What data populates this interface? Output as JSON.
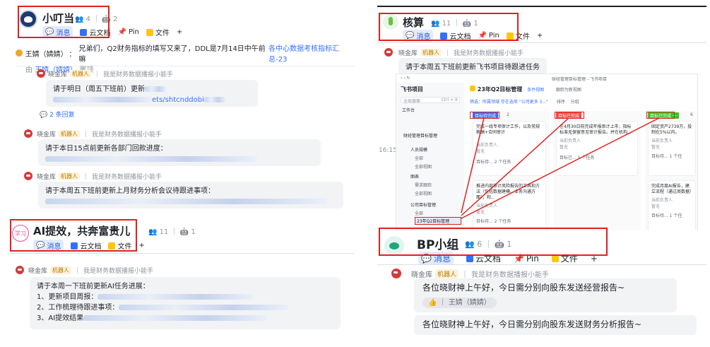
{
  "group1": {
    "name": "小叮当",
    "members": "4",
    "bots": "2",
    "tabs": [
      "消息",
      "云文档",
      "Pin",
      "文件",
      "+"
    ],
    "pin": {
      "author": "王婧（婧婧）",
      "text": "兄弟们，Q2财务指标的填写又来了，DDL是7月14日中午前嘛",
      "link": "各中心数据考核指标汇总-23",
      "meta_author": "王婧（婧婧）",
      "meta_action": "置顶"
    },
    "messages": [
      {
        "sender": "晓金库",
        "tag": "机器人",
        "desc": "我是财务数据播报小能手",
        "text": "请于明日（周五下班前）更新",
        "link_tail": "ets/shtcnddobi",
        "replies": "2 条回复"
      },
      {
        "sender": "晓金库",
        "tag": "机器人",
        "desc": "我是财务数据播报小能手",
        "text": "请于本日15点前更新各部门回款进度："
      },
      {
        "sender": "晓金库",
        "tag": "机器人",
        "desc": "我是财务数据播报小能手",
        "text": "请于本周五下班前更新上月财务分析会议待跟进事项："
      }
    ]
  },
  "group2": {
    "avatar_text": "学习",
    "name": "AI提效，共奔富贵儿",
    "members": "11",
    "bots": "1",
    "tabs": [
      "消息",
      "云文档",
      "文件",
      "+"
    ],
    "message": {
      "sender": "晓金库",
      "tag": "机器人",
      "desc": "我是财务数据播报小能手",
      "lines": [
        "请于本周一下班前更新AI任务进展：",
        "1、更新项目周报：",
        "2、工作梳理待跟进事项：",
        "3、AI提效结果"
      ]
    }
  },
  "group3": {
    "name": "核算",
    "members": "11",
    "bots": "1",
    "tabs": [
      "消息",
      "云文档",
      "Pin",
      "文件",
      "+"
    ],
    "message": {
      "sender": "晓金库",
      "tag": "机器人",
      "desc": "我是财务数据播报小能手",
      "text": "请于本周五下班前更新飞书项目待跟进任务"
    },
    "time": "16:15",
    "screenshot": {
      "window_title": "财经管理目标管理 - 飞书项目",
      "app_name": "飞书项目",
      "search": "全局搜索",
      "shortcut": "Ctrl + K",
      "workbench": "工作台",
      "nav": [
        "财经管理目标管理",
        "人员规模",
        "全部",
        "全部视图",
        "图表",
        "需求跟踪",
        "全部视图",
        "公司目标管理",
        "全部",
        "23年Q2目标管理"
      ],
      "board_title": "23年Q2目标管理",
      "toolbar": [
        "条件视图",
        "筛选",
        "排序",
        "分组"
      ],
      "extra": "跟踪为新视图",
      "filter": "筛选：所属领域 存在选项 \"公司更多 3...\"",
      "columns": [
        {
          "label": "目标待完成",
          "count": "2"
        },
        {
          "label": "目标已完成",
          "count": ""
        },
        {
          "label": "目标已完成 一",
          "count": "6"
        }
      ],
      "cards": [
        {
          "text": "完成一线专项审计工作，以及常规薪酬+合同审计",
          "owner": "当前负责人",
          "none": "暂无",
          "foot": "目标待...",
          "count": "2 个任务"
        },
        {
          "text": "在4月30日前完成年报审计上市，指标标准无保留意见审计报告。并在机构...",
          "owner": "当前负责人",
          "none": "暂无",
          "foot": "目标已...",
          "count": "1 个任务"
        },
        {
          "text": "固定资产2739万，投制在5%以内。",
          "owner": "当前负责人",
          "none": "暂无",
          "foot": "目标待...",
          "count": "1 个任"
        },
        {
          "text": "推进内部审计风险报告的工具和方法（包括数据建模、业务沟通方面），和...",
          "owner": "当前负责人",
          "none": "暂无",
          "foot": "目标待...",
          "count": "2 个任务"
        },
        {
          "text": "完成月度AI报告，建立流程（通过周数据）",
          "owner": "当前负责人",
          "none": "暂无",
          "foot": "目标待...",
          "count": "1 个任"
        }
      ]
    }
  },
  "group4": {
    "name": "BP小组",
    "members": "6",
    "bots": "1",
    "tabs": [
      "消息",
      "云文档",
      "Pin",
      "文件",
      "+"
    ],
    "message": {
      "sender": "晓金库",
      "tag": "机器人",
      "desc": "我是财务数据播报小能手"
    },
    "bubble1": "各位晓财神上午好，今日需分别向股东发送经营报告~",
    "reaction": "王婧（婧婧）",
    "bubble2": "各位晓财神上午好，今日需分别向股东发送财务分析报告~"
  },
  "colors": {
    "red": "#e02020",
    "blue": "#3370ff",
    "teal": "#00b96b"
  }
}
